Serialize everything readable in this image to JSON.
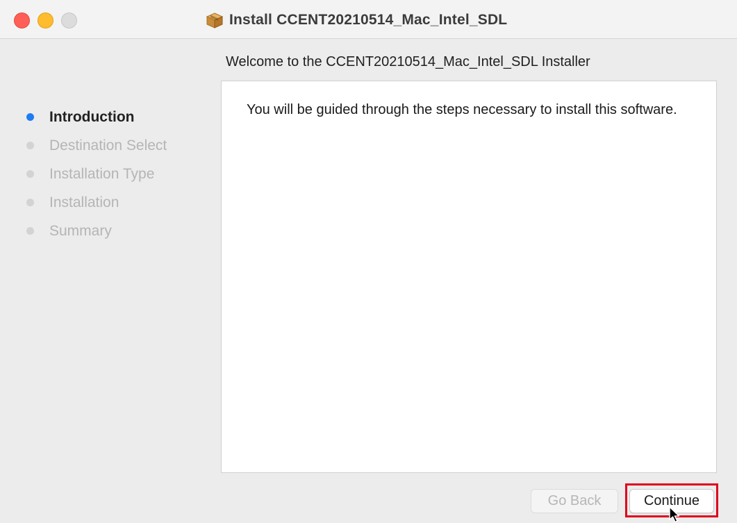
{
  "window": {
    "title": "Install CCENT20210514_Mac_Intel_SDL",
    "title_icon": "package-icon"
  },
  "traffic_lights": {
    "close_color": "#ff5f57",
    "minimize_color": "#febc2e",
    "zoom_color": "#dcdcdc"
  },
  "header": {
    "welcome": "Welcome to the CCENT20210514_Mac_Intel_SDL Installer"
  },
  "sidebar": {
    "steps": [
      {
        "label": "Introduction",
        "active": true
      },
      {
        "label": "Destination Select",
        "active": false
      },
      {
        "label": "Installation Type",
        "active": false
      },
      {
        "label": "Installation",
        "active": false
      },
      {
        "label": "Summary",
        "active": false
      }
    ],
    "active_color": "#1f7cf4"
  },
  "main": {
    "body_text": "You will be guided through the steps necessary to install this software."
  },
  "buttons": {
    "back_label": "Go Back",
    "continue_label": "Continue"
  },
  "annotation": {
    "highlight_color": "#e0001b"
  }
}
